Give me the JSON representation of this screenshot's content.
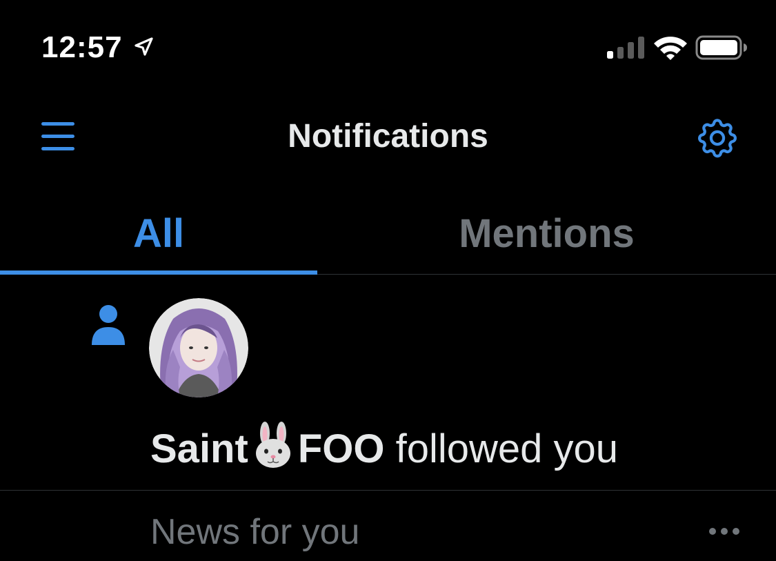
{
  "status_bar": {
    "time": "12:57",
    "icons": [
      "location-arrow-icon",
      "cellular-signal-icon",
      "wifi-icon",
      "battery-icon"
    ]
  },
  "header": {
    "title": "Notifications",
    "left_icon": "menu-icon",
    "right_icon": "gear-icon"
  },
  "tabs": [
    {
      "label": "All",
      "active": true
    },
    {
      "label": "Mentions",
      "active": false
    }
  ],
  "notification": {
    "type_icon": "person-icon",
    "avatar": "avatar",
    "name_part1": "Saint",
    "name_emoji": "rabbit-face-icon",
    "name_part2": "FOO",
    "action": " followed you"
  },
  "news": {
    "title": "News for you",
    "more_icon": "more-options-icon"
  },
  "colors": {
    "background": "#000000",
    "accent": "#3d8ee6",
    "muted": "#71767b",
    "text": "#e7e9ea",
    "divider": "#2f3336"
  }
}
